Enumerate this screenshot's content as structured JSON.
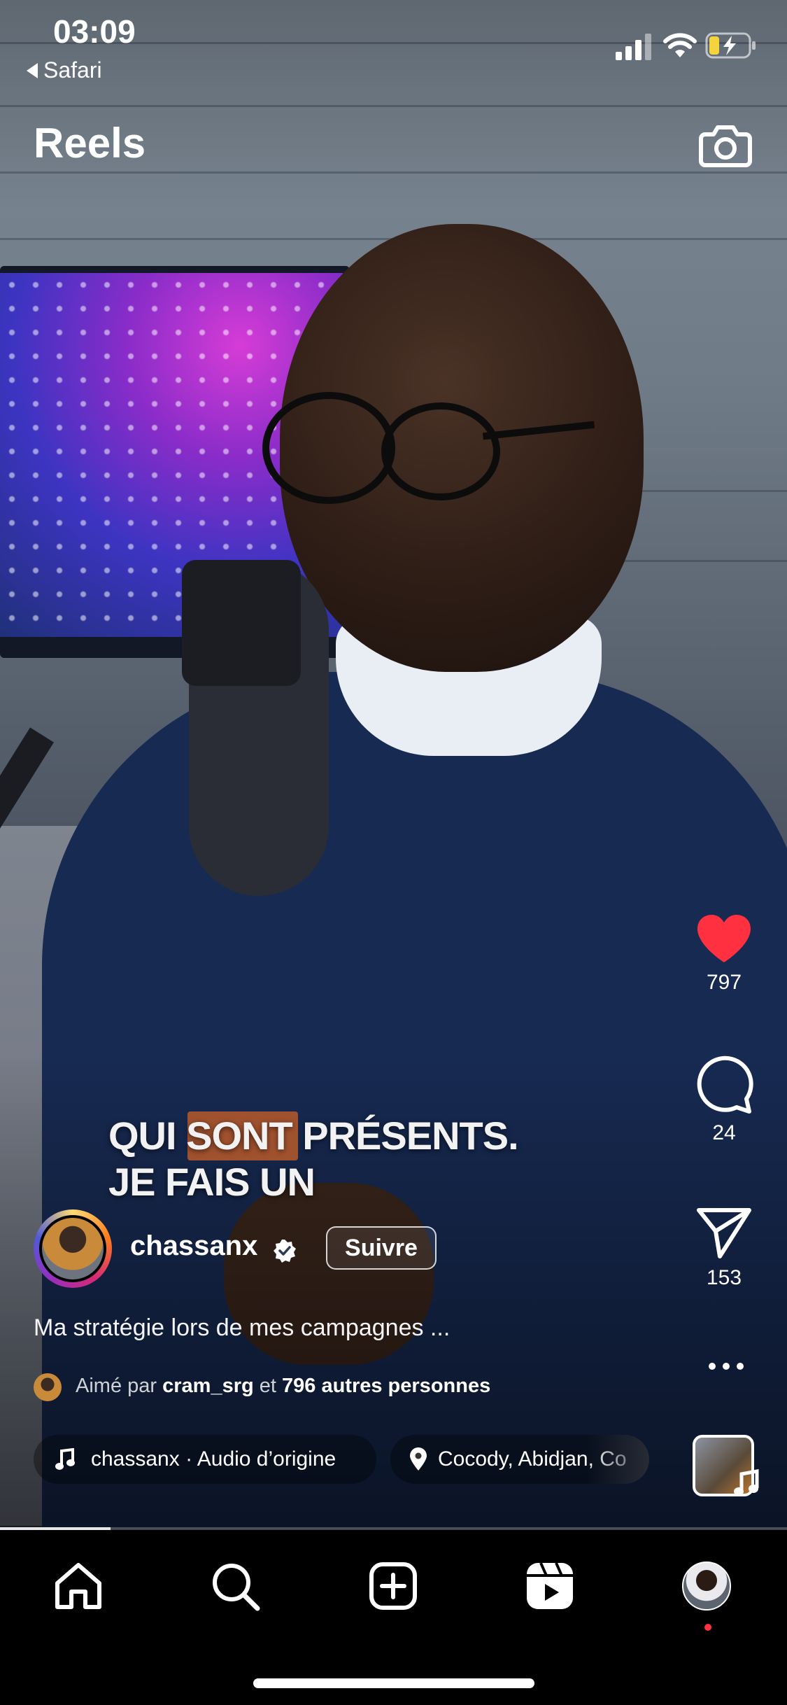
{
  "status_bar": {
    "time": "03:09",
    "back_app": "Safari"
  },
  "header": {
    "title": "Reels",
    "camera_icon": "camera-icon"
  },
  "video": {
    "caption_line1": "QUI SONT PRÉSENTS.",
    "caption_line2": "JE FAIS UN",
    "progress": 0.14
  },
  "actions": {
    "like_count": "797",
    "comment_count": "24",
    "share_count": "153",
    "like_color": "#ff3040"
  },
  "post": {
    "username": "chassanx",
    "follow_label": "Suivre",
    "caption": "Ma stratégie lors de mes campagnes ...",
    "liked_prefix": "Aimé par",
    "liked_user": "cram_srg",
    "liked_joiner": "et",
    "liked_others": "796 autres personnes",
    "audio": "chassanx · Audio d’origine",
    "location": "Cocody, Abidjan, Co"
  },
  "tabbar": {
    "items": [
      "home-icon",
      "search-icon",
      "create-icon",
      "reels-icon",
      "profile-avatar"
    ],
    "notification_color": "#ff3040"
  }
}
